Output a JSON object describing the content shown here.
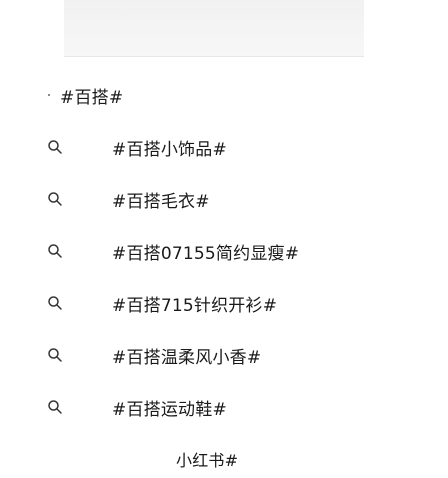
{
  "header": {
    "bar": ""
  },
  "history": {
    "label": "#百搭#"
  },
  "suggestions": [
    {
      "label": "#百搭小饰品#"
    },
    {
      "label": "#百搭毛衣#"
    },
    {
      "label": "#百搭07155简约显瘦#"
    },
    {
      "label": "#百搭715针织开衫#"
    },
    {
      "label": "#百搭温柔风小香#"
    },
    {
      "label": "#百搭运动鞋#"
    }
  ],
  "more": {
    "label": "小红书#"
  }
}
